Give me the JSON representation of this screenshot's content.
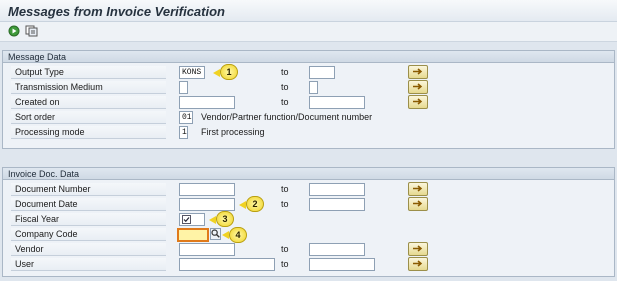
{
  "window": {
    "title": "Messages from Invoice Verification"
  },
  "toolbar": {
    "buttons": [
      {
        "icon": "execute-icon"
      },
      {
        "icon": "get-variant-icon"
      }
    ]
  },
  "message_data": {
    "header": "Message Data",
    "rows": [
      {
        "label": "Output Type",
        "value": "KONS",
        "to": "to",
        "badge": "1"
      },
      {
        "label": "Transmission Medium",
        "value": "",
        "to": "to"
      },
      {
        "label": "Created on",
        "value": "",
        "to": "to"
      },
      {
        "label": "Sort order",
        "value": "01",
        "desc": "Vendor/Partner function/Document number"
      },
      {
        "label": "Processing mode",
        "value": "1",
        "desc": "First processing"
      }
    ]
  },
  "invoice_data": {
    "header": "Invoice Doc. Data",
    "rows": [
      {
        "label": "Document Number",
        "value": "",
        "to": "to"
      },
      {
        "label": "Document Date",
        "value": "",
        "to": "to",
        "badge": "2"
      },
      {
        "label": "Fiscal Year",
        "value": "",
        "badge": "3"
      },
      {
        "label": "Company Code",
        "value": "",
        "badge": "4"
      },
      {
        "label": "Vendor",
        "value": "",
        "to": "to"
      },
      {
        "label": "User",
        "value": "",
        "to": "to"
      }
    ]
  },
  "colors": {
    "accent": "#f0d224",
    "highlight": "#e07a1a"
  }
}
